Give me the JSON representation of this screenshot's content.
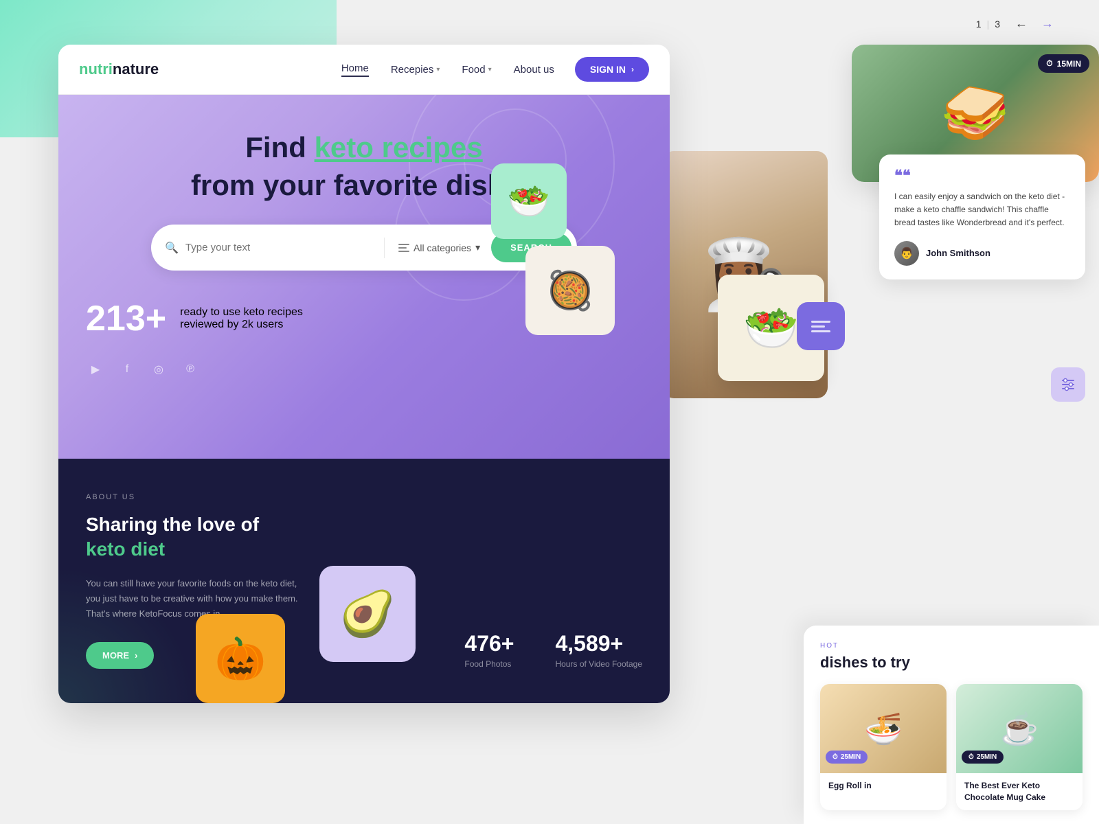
{
  "brand": {
    "nutri": "nutri",
    "nature": "nature"
  },
  "navbar": {
    "home": "Home",
    "recipes": "Recepies",
    "food": "Food",
    "about": "About us",
    "signin": "SIGN IN"
  },
  "pagination": {
    "current": "1",
    "total": "3"
  },
  "hero": {
    "heading_line1": "Find ",
    "heading_highlight": "keto recipes",
    "heading_line2": "from your favorite dishes",
    "search_placeholder": "Type your text",
    "categories_label": "All categories",
    "search_button": "SEARCH",
    "stats_number": "213+",
    "stats_desc_line1": "ready to use keto recipes",
    "stats_desc_line2": "reviewed by 2k users"
  },
  "about": {
    "label": "ABOUT US",
    "title_line1": "Sharing the love of",
    "title_line2_normal": "",
    "title_highlight": "keto diet",
    "description": "You can still have your favorite foods on the keto diet, you just have to be creative with how you make them. That's where KetoFocus comes in.",
    "more_button": "MORE",
    "stat1_number": "476+",
    "stat1_label": "Food Photos",
    "stat2_number": "4,589+",
    "stat2_label": "Hours of Video Footage"
  },
  "testimonial": {
    "quote_mark": "❝❝",
    "text": "I can easily enjoy a sandwich on the keto diet - make a keto chaffle sandwich! This chaffle bread tastes like Wonderbread and it's perfect.",
    "author": "John Smithson"
  },
  "top_food_card": {
    "time": "15MIN"
  },
  "blog": {
    "label": "HOT",
    "title": "dishes to try",
    "card1_title": "Egg Roll in",
    "card1_time": "25MIN",
    "card2_title": "The Best Ever Keto Chocolate Mug Cake",
    "card2_time": "25MIN"
  },
  "colors": {
    "green": "#4eca8b",
    "purple": "#7b6be0",
    "dark_navy": "#1a1a3e",
    "hero_purple": "#b89ee8"
  }
}
